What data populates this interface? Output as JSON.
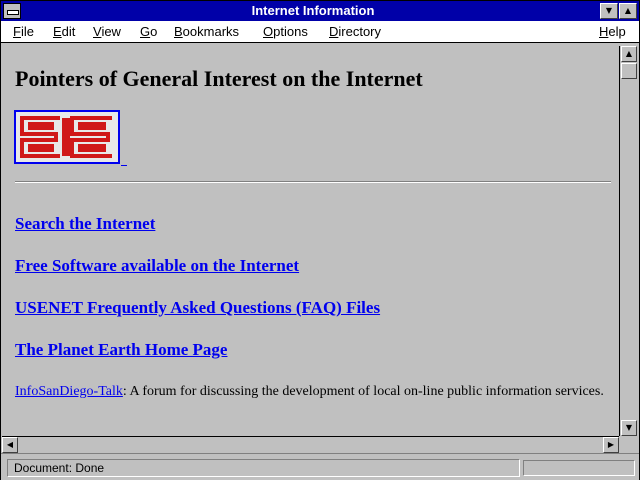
{
  "window": {
    "title": "Internet Information"
  },
  "menubar": {
    "items": [
      "File",
      "Edit",
      "View",
      "Go",
      "Bookmarks",
      "Options",
      "Directory",
      "Help"
    ]
  },
  "content": {
    "heading": "Pointers of General Interest on the Internet",
    "logo": {
      "icon": "sdsc-maze-logo",
      "colors": {
        "red": "#d01818",
        "frame": "#0000ee"
      }
    },
    "links": [
      "Search the Internet",
      "Free Software available on the Internet",
      "USENET Frequently Asked Questions (FAQ) Files",
      "The Planet Earth Home Page"
    ],
    "paragraph": {
      "link": "InfoSanDiego-Talk",
      "text": ": A forum for discussing the development of local on-line public information services."
    }
  },
  "status": {
    "text": "Document: Done",
    "progress": 0
  },
  "colors": {
    "titlebar": "#0000a8",
    "link": "#0000ee",
    "background": "#c0c0c0"
  }
}
